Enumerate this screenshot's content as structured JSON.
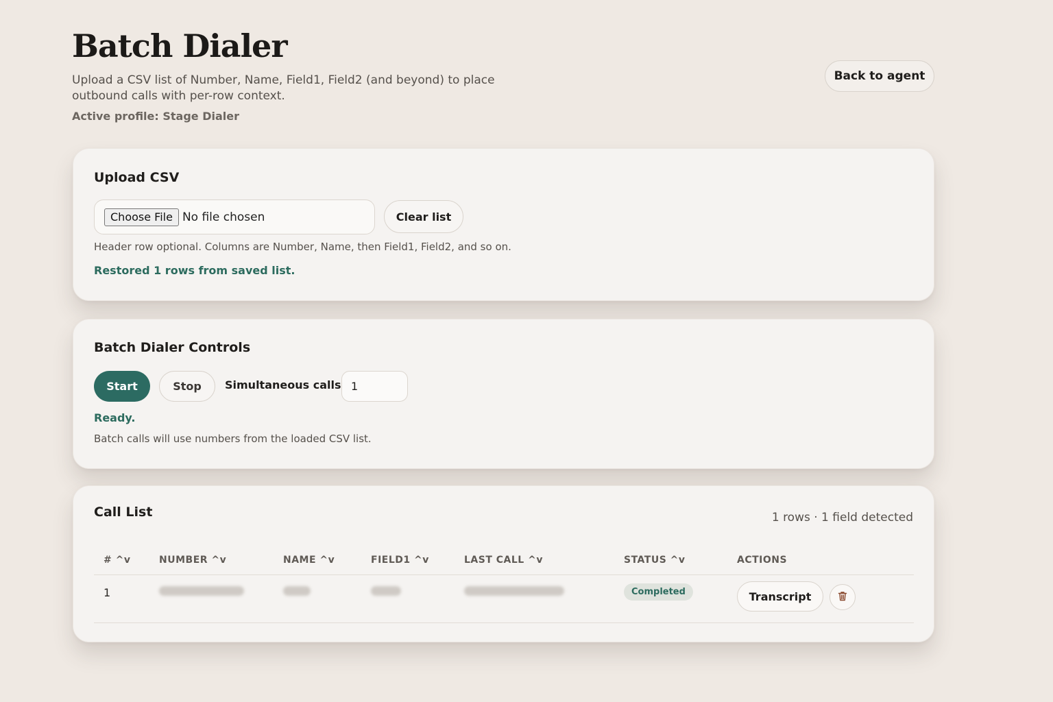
{
  "header": {
    "title": "Batch Dialer",
    "subtitle": "Upload a CSV list of Number, Name, Field1, Field2 (and beyond) to place outbound calls with per-row context.",
    "active_profile": "Active profile: Stage Dialer",
    "back_label": "Back to agent"
  },
  "upload": {
    "title": "Upload CSV",
    "choose_file_label": "Choose File",
    "no_file_text": "No file chosen",
    "clear_label": "Clear list",
    "help_text": "Header row optional. Columns are Number, Name, then Field1, Field2, and so on.",
    "status_text": "Restored 1 rows from saved list."
  },
  "controls": {
    "title": "Batch Dialer Controls",
    "start_label": "Start",
    "stop_label": "Stop",
    "simultaneous_label": "Simultaneous calls",
    "simultaneous_value": "1",
    "status_text": "Ready.",
    "help_text": "Batch calls will use numbers from the loaded CSV list."
  },
  "call_list": {
    "title": "Call List",
    "summary": "1 rows · 1 field detected",
    "columns": [
      "# ^v",
      "NUMBER ^v",
      "NAME ^v",
      "FIELD1 ^v",
      "LAST CALL ^v",
      "STATUS ^v",
      "ACTIONS"
    ],
    "rows": [
      {
        "index": "1",
        "status": "Completed",
        "transcript_label": "Transcript",
        "delete_icon": "trash-icon"
      }
    ]
  },
  "colors": {
    "accent": "#2c6b62",
    "success_text": "#2c6b5e",
    "background": "#efe9e3",
    "card": "#f5f3f1",
    "delete_icon": "#8a4a2f"
  }
}
